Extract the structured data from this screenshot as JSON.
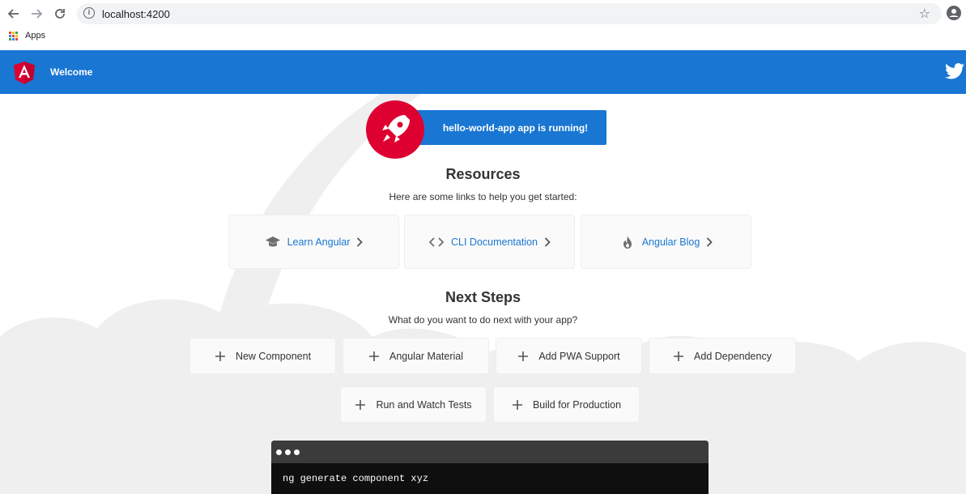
{
  "browser": {
    "url": "localhost:4200",
    "bookmarks_apps_label": "Apps",
    "icons": {
      "back": "arrow-left-icon",
      "forward": "arrow-right-icon",
      "reload": "reload-icon",
      "info": "info-icon",
      "star": "star-icon",
      "profile": "account-circle-icon",
      "apps": "apps-grid-icon"
    }
  },
  "toolbar": {
    "title": "Welcome",
    "logo_icon": "angular-logo-icon",
    "twitter_icon": "twitter-icon",
    "color": "#1976d2"
  },
  "banner": {
    "text": "hello-world-app app is running!",
    "icon": "rocket-icon",
    "circle_color": "#dd0031"
  },
  "resources": {
    "title": "Resources",
    "subtitle": "Here are some links to help you get started:",
    "cards": [
      {
        "label": "Learn Angular",
        "icon": "graduation-cap-icon"
      },
      {
        "label": "CLI Documentation",
        "icon": "code-brackets-icon"
      },
      {
        "label": "Angular Blog",
        "icon": "flame-icon"
      }
    ]
  },
  "next_steps": {
    "title": "Next Steps",
    "subtitle": "What do you want to do next with your app?",
    "cards": [
      {
        "label": "New Component"
      },
      {
        "label": "Angular Material"
      },
      {
        "label": "Add PWA Support"
      },
      {
        "label": "Add Dependency"
      },
      {
        "label": "Run and Watch Tests"
      },
      {
        "label": "Build for Production"
      }
    ]
  },
  "terminal": {
    "command": "ng generate component xyz"
  }
}
